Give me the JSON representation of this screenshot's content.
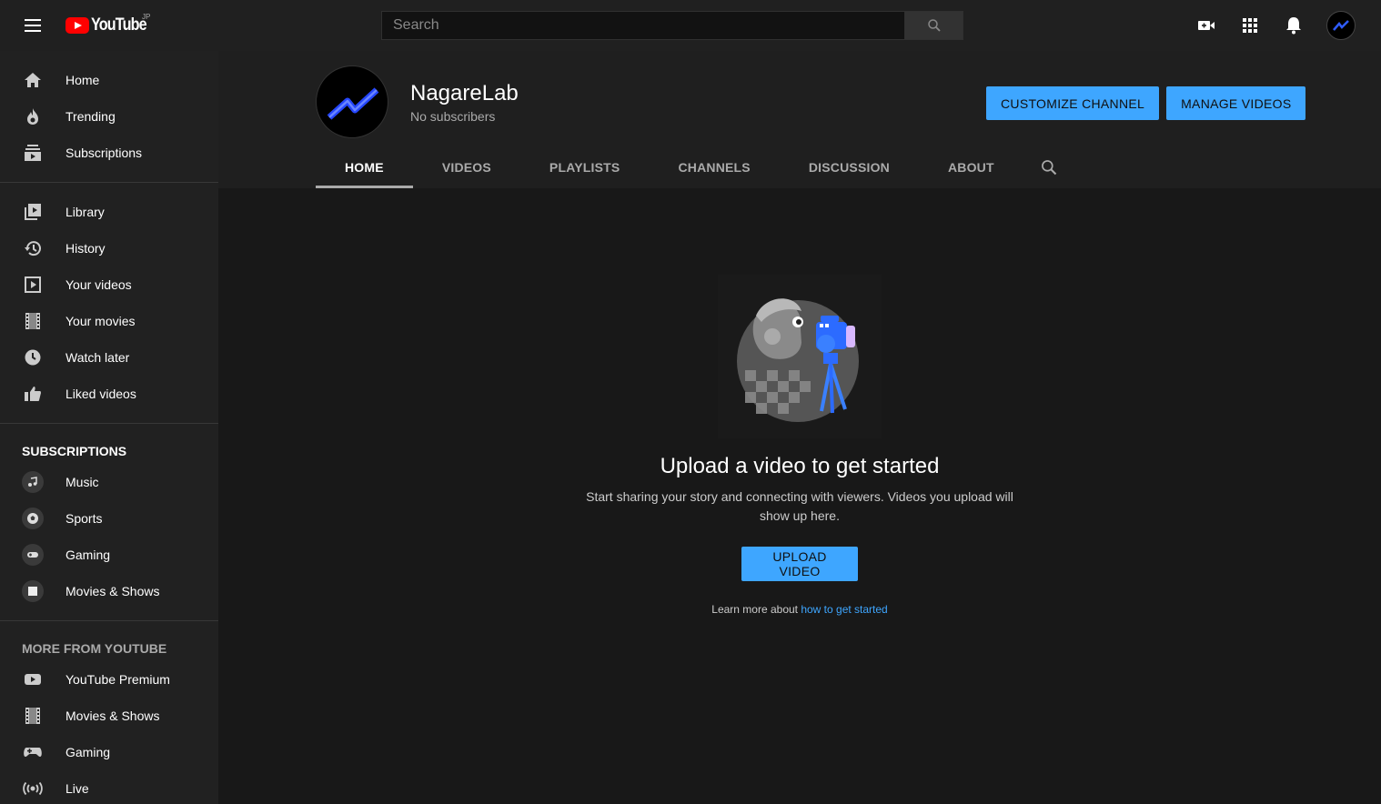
{
  "topbar": {
    "logo_text": "YouTube",
    "logo_region": "JP",
    "search_placeholder": "Search"
  },
  "sidebar": {
    "main": [
      {
        "label": "Home",
        "icon": "home-icon"
      },
      {
        "label": "Trending",
        "icon": "flame-icon"
      },
      {
        "label": "Subscriptions",
        "icon": "subscriptions-icon"
      }
    ],
    "library": [
      {
        "label": "Library",
        "icon": "library-icon"
      },
      {
        "label": "History",
        "icon": "history-icon"
      },
      {
        "label": "Your videos",
        "icon": "your-videos-icon"
      },
      {
        "label": "Your movies",
        "icon": "film-icon"
      },
      {
        "label": "Watch later",
        "icon": "clock-icon"
      },
      {
        "label": "Liked videos",
        "icon": "thumbs-up-icon"
      }
    ],
    "subscriptions_header": "SUBSCRIPTIONS",
    "subscriptions": [
      {
        "label": "Music",
        "icon": "music-note-icon"
      },
      {
        "label": "Sports",
        "icon": "sports-ball-icon"
      },
      {
        "label": "Gaming",
        "icon": "gamepad-icon"
      },
      {
        "label": "Movies & Shows",
        "icon": "movies-icon"
      }
    ],
    "more_header": "MORE FROM YOUTUBE",
    "more": [
      {
        "label": "YouTube Premium",
        "icon": "youtube-premium-icon"
      },
      {
        "label": "Movies & Shows",
        "icon": "film-icon"
      },
      {
        "label": "Gaming",
        "icon": "gamepad-icon"
      },
      {
        "label": "Live",
        "icon": "live-icon"
      }
    ]
  },
  "channel": {
    "name": "NagareLab",
    "subscribers": "No subscribers",
    "customize_label": "CUSTOMIZE CHANNEL",
    "manage_label": "MANAGE VIDEOS",
    "tabs": [
      "HOME",
      "VIDEOS",
      "PLAYLISTS",
      "CHANNELS",
      "DISCUSSION",
      "ABOUT"
    ],
    "active_tab": "HOME"
  },
  "empty_state": {
    "title": "Upload a video to get started",
    "description": "Start sharing your story and connecting with viewers. Videos you upload will show up here.",
    "upload_label": "UPLOAD VIDEO",
    "learn_prefix": "Learn more about ",
    "learn_link": "how to get started"
  },
  "colors": {
    "accent": "#3ea6ff",
    "brand_red": "#ff0000",
    "background": "#181818",
    "sidebar": "#212121",
    "topbar": "#202020"
  }
}
